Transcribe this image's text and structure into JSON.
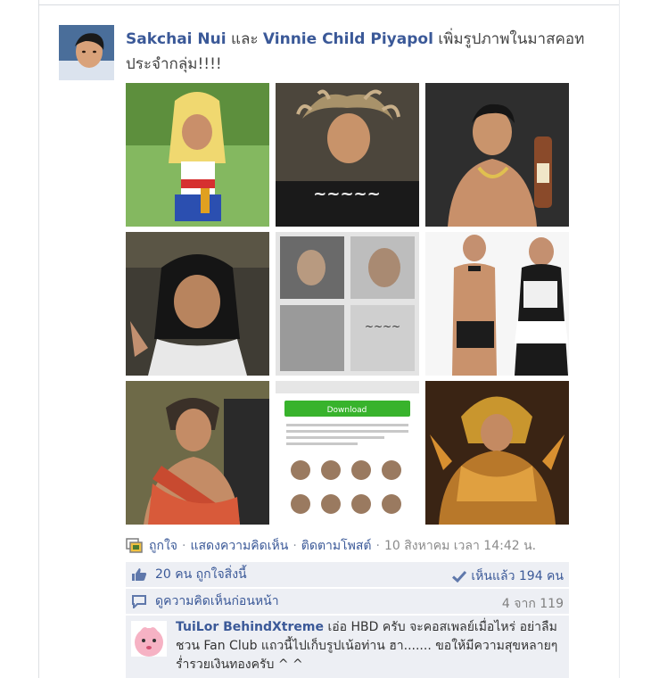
{
  "post": {
    "actor1": "Sakchai Nui",
    "connector": "และ",
    "actor2": "Vinnie Child Piyapol",
    "action_text": "เพิ่มรูปภาพในมาสคอท",
    "action_text2": "ประจำกลุ่ม!!!!"
  },
  "photos": [
    {
      "name": "photo-1",
      "bg": "#7db35a",
      "accent": "#f0d870"
    },
    {
      "name": "photo-2",
      "bg": "#5a5246",
      "accent": "#c9b08a"
    },
    {
      "name": "photo-3",
      "bg": "#2a2a2a",
      "accent": "#c89a70"
    },
    {
      "name": "photo-4",
      "bg": "#3b3a34",
      "accent": "#b08060"
    },
    {
      "name": "photo-5",
      "bg": "#8a8a8a",
      "accent": "#d0d0d0"
    },
    {
      "name": "photo-6",
      "bg": "#f4f4f4",
      "accent": "#c49070"
    },
    {
      "name": "photo-7",
      "bg": "#6f6a4a",
      "accent": "#c84a30"
    },
    {
      "name": "photo-8",
      "bg": "#e6e6e6",
      "accent": "#38b32c",
      "download_label": "Download"
    },
    {
      "name": "photo-9",
      "bg": "#3a2212",
      "accent": "#e0a040"
    }
  ],
  "actions": {
    "like": "ถูกใจ",
    "comment": "แสดงความคิดเห็น",
    "follow": "ติดตามโพสต์",
    "timestamp": "10 สิงหาคม เวลา 14:42 น."
  },
  "ufi": {
    "likes": "20 คน ถูกใจสิ่งนี้",
    "seen": "เห็นแล้ว 194 คน",
    "view_previous": "ดูความคิดเห็นก่อนหน้า",
    "comment_count": "4 จาก 119"
  },
  "comment": {
    "author": "TuiLor BehindXtreme",
    "text": "เอ่อ HBD ครับ จะคอสเพลย์เมื่อไหร่ อย่าลืมชวน Fan Club แถวนี้ไปเก็บรูปเน้อท่าน ฮา....... ขอให้มีความสุขหลายๆ ร่ำรวยเงินทองครับ ^ ^"
  },
  "colors": {
    "link": "#3b5998",
    "ufi_bg": "#edeff4",
    "muted": "#8b8b8b"
  }
}
